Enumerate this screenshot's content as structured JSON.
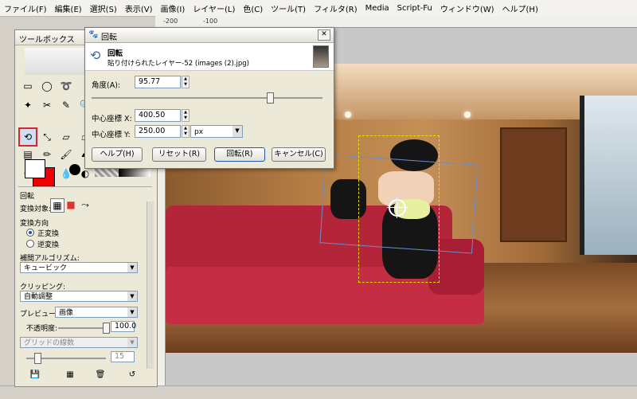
{
  "menubar": {
    "items": [
      "ファイル(F)",
      "編集(E)",
      "選択(S)",
      "表示(V)",
      "画像(I)",
      "レイヤー(L)",
      "色(C)",
      "ツール(T)",
      "フィルタ(R)",
      "Media",
      "Script-Fu",
      "ウィンドウ(W)",
      "ヘルプ(H)"
    ]
  },
  "ruler": {
    "ticks": [
      "-200",
      "-100"
    ]
  },
  "toolbox": {
    "title": "ツールボックス",
    "tool_options": {
      "title": "回転",
      "transform_target_label": "変換対象:",
      "direction_label": "変換方向",
      "direction_forward": "正変換",
      "direction_reverse": "逆変換",
      "interpolation_label": "補間アルゴリズム:",
      "interpolation_value": "キュービック",
      "clipping_label": "クリッピング:",
      "clipping_value": "自動調整",
      "preview_label": "プレビュー:",
      "preview_value": "画像",
      "opacity_label": "不透明度:",
      "opacity_value": "100.0",
      "grid_label": "グリッドの線数",
      "grid_value": "15"
    }
  },
  "dialog": {
    "title": "回転",
    "header_title": "回転",
    "header_subtitle": "貼り付けられたレイヤー-52 (images (2).jpg)",
    "angle_label": "角度(A):",
    "angle_value": "95.77",
    "angle_slider_fraction": 0.77,
    "center_x_label": "中心座標 X:",
    "center_x_value": "400.50",
    "center_y_label": "中心座標 Y:",
    "center_y_value": "250.00",
    "unit_value": "px",
    "buttons": {
      "help": "ヘルプ(H)",
      "reset": "リセット(R)",
      "rotate": "回転(R)",
      "cancel": "キャンセル(C)"
    }
  },
  "colors": {
    "accent_selected_tool": "#d9262b",
    "background_color_swatch": "#ee0000",
    "foreground_color_swatch": "#ffffff"
  }
}
